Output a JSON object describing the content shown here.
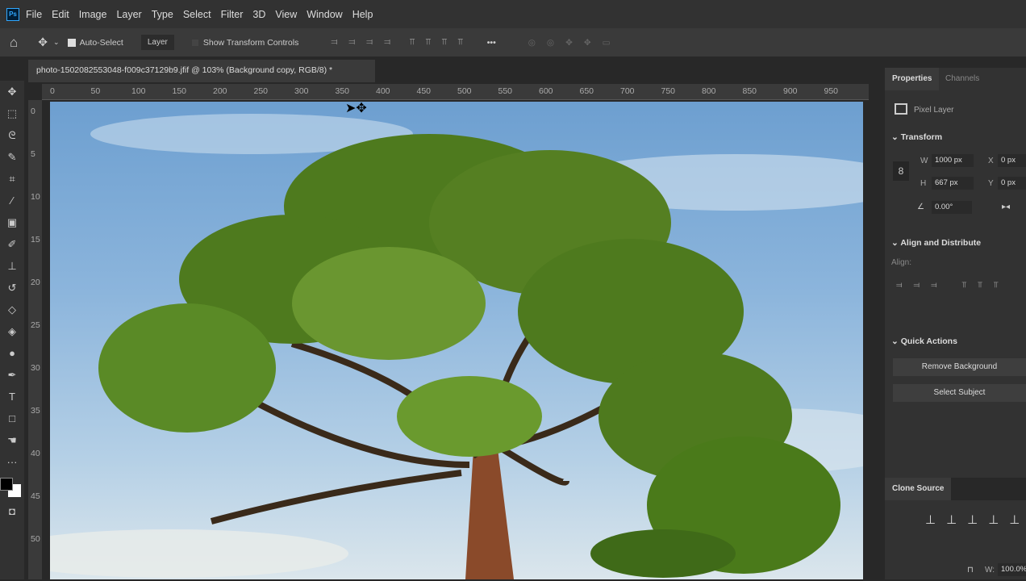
{
  "app": {
    "logo": "Ps"
  },
  "menu": [
    "File",
    "Edit",
    "Image",
    "Layer",
    "Type",
    "Select",
    "Filter",
    "3D",
    "View",
    "Window",
    "Help"
  ],
  "options": {
    "auto_select_label": "Auto-Select",
    "auto_select_checked": true,
    "target_select": "Layer",
    "show_transform_label": "Show Transform Controls",
    "more": "•••"
  },
  "document": {
    "tab_title": "photo-1502082553048-f009c37129b9.jfif @ 103% (Background copy, RGB/8) *"
  },
  "ruler": {
    "h": [
      "0",
      "50",
      "100",
      "150",
      "200",
      "250",
      "300",
      "350",
      "400",
      "450",
      "500",
      "550",
      "600",
      "650",
      "700",
      "750",
      "800",
      "850",
      "900",
      "950"
    ],
    "v": [
      "0",
      "5",
      "10",
      "15",
      "20",
      "25",
      "30",
      "35",
      "40",
      "45",
      "50"
    ]
  },
  "properties": {
    "tabs": [
      "Properties",
      "Channels"
    ],
    "layer_type": "Pixel Layer",
    "transform_title": "Transform",
    "w_label": "W",
    "w": "1000 px",
    "h_label": "H",
    "h": "667 px",
    "x_label": "X",
    "x": "0 px",
    "y_label": "Y",
    "y": "0 px",
    "angle": "0.00°",
    "align_title": "Align and Distribute",
    "align_label": "Align:",
    "quick_actions_title": "Quick Actions",
    "remove_bg": "Remove Background",
    "select_subject": "Select Subject"
  },
  "clone_source": {
    "title": "Clone Source",
    "w_label": "W:",
    "w": "100.0%"
  }
}
